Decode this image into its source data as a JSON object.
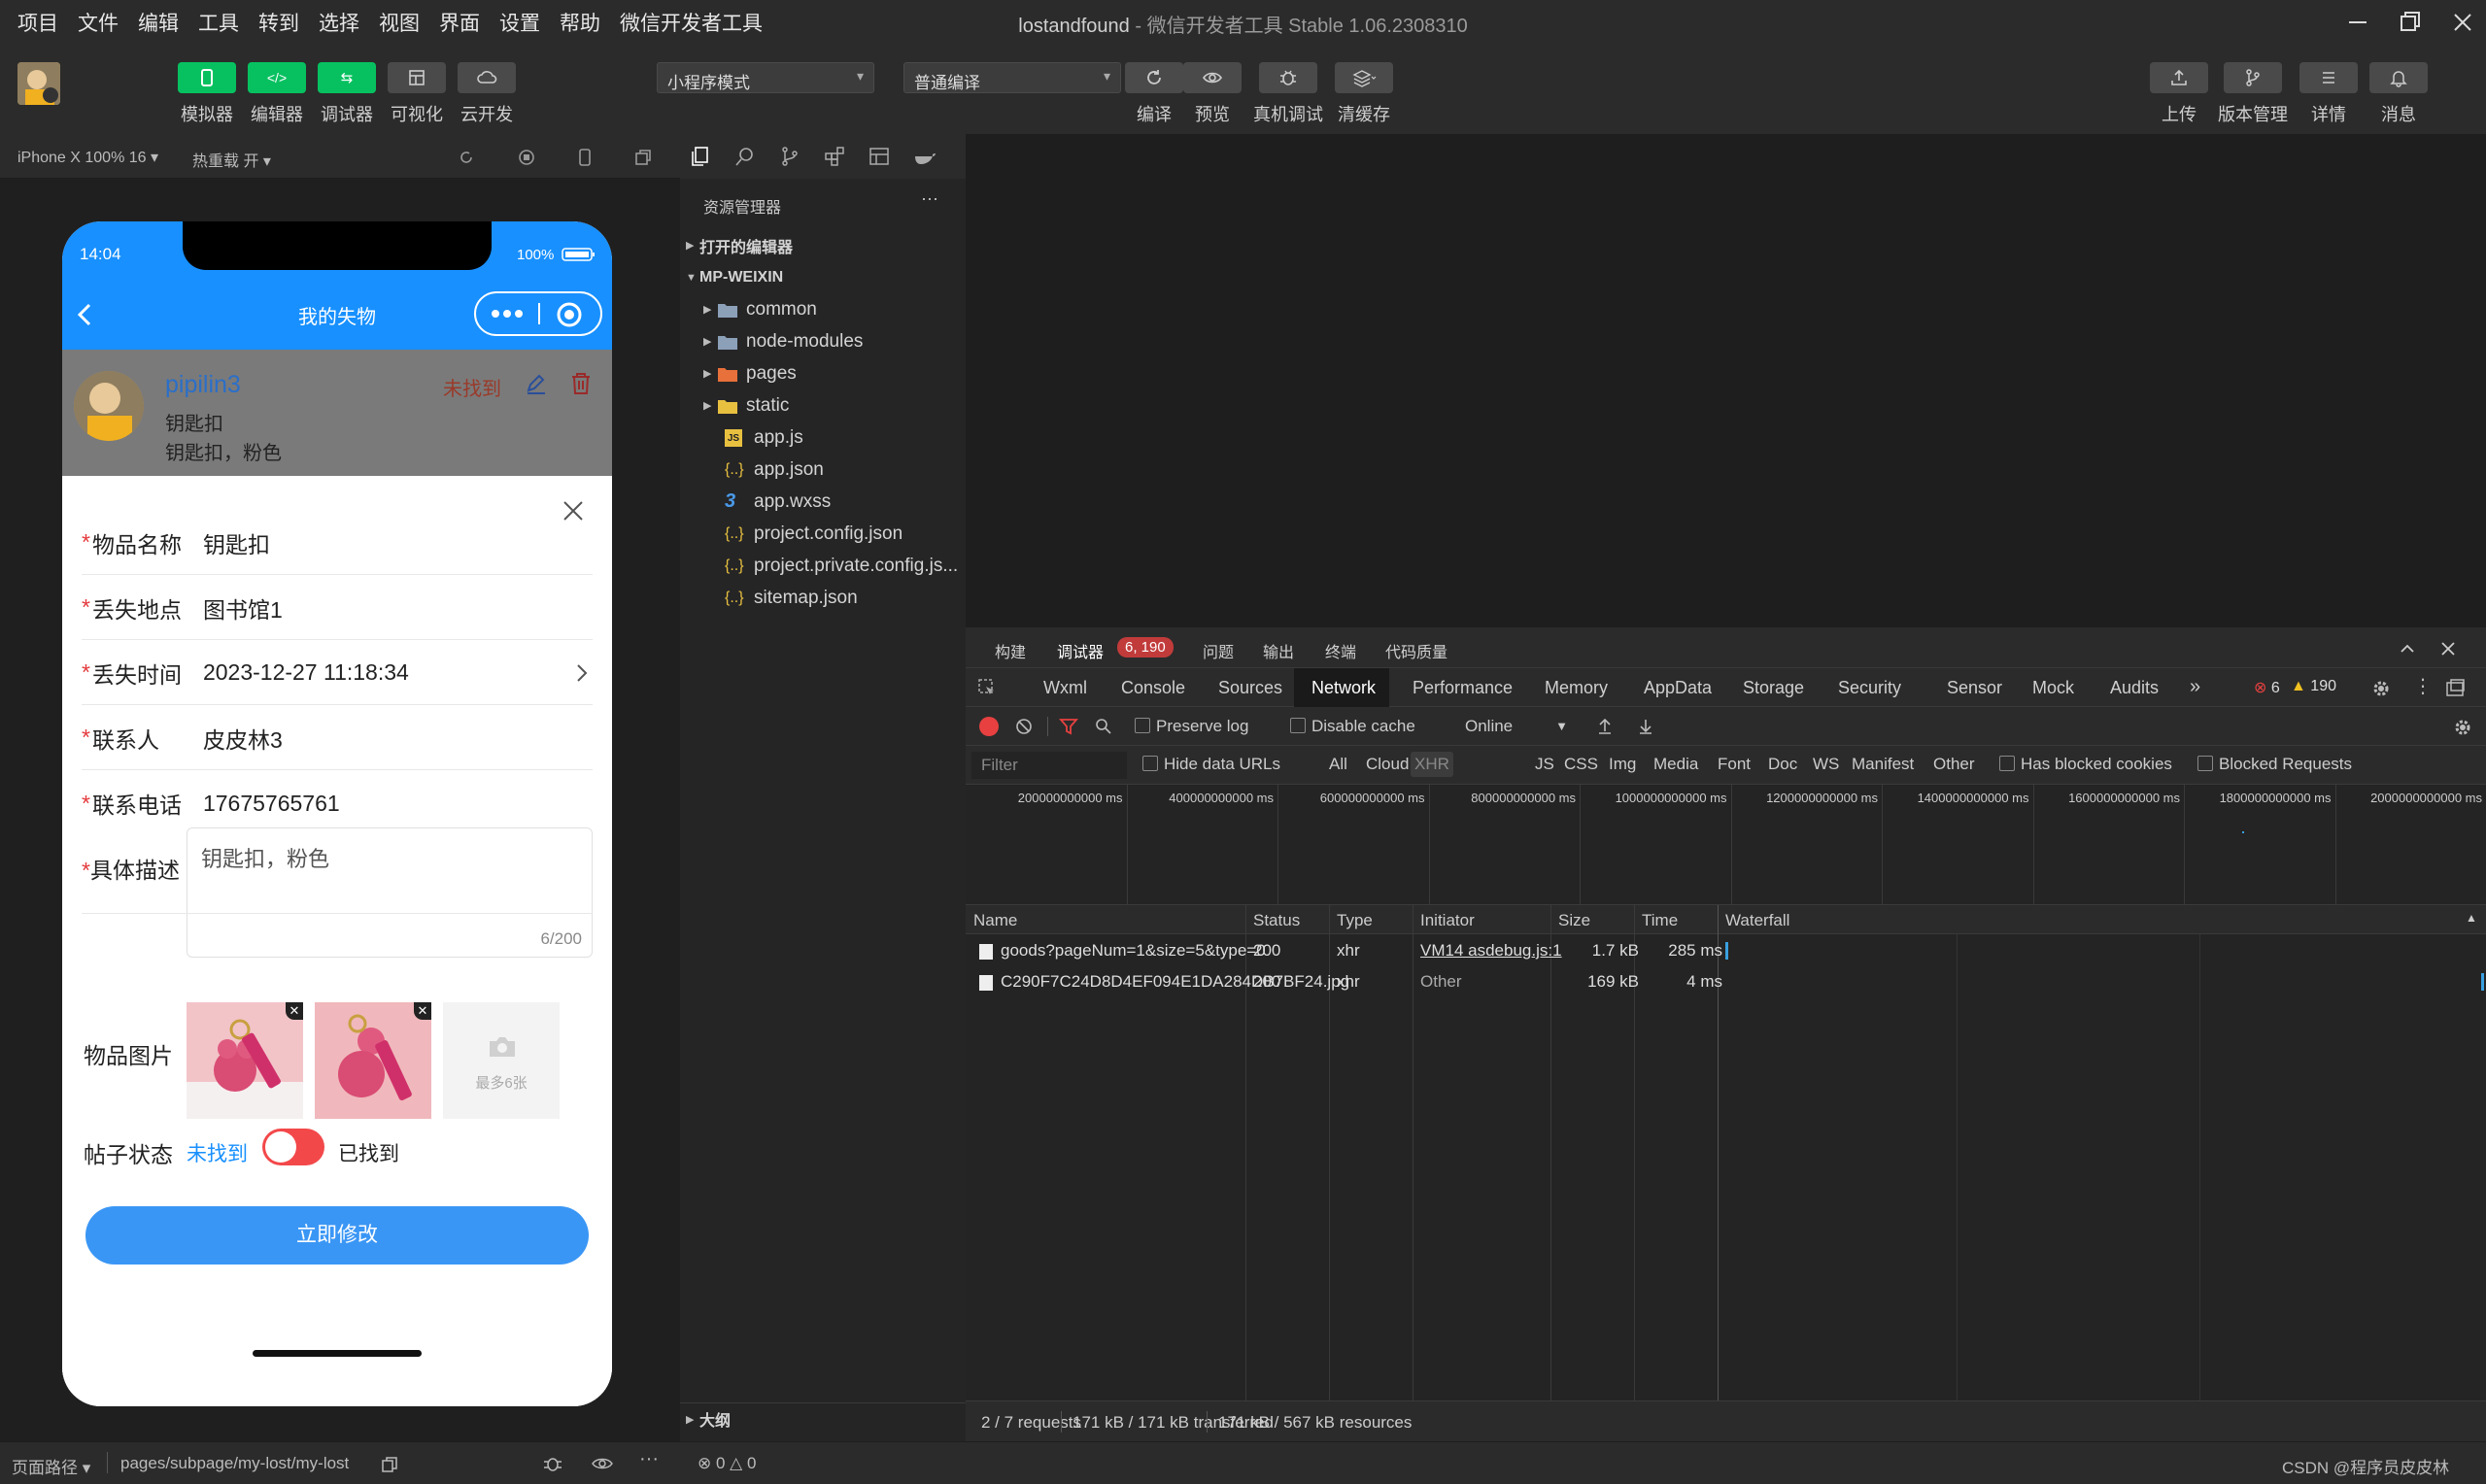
{
  "menubar": {
    "items": [
      "项目",
      "文件",
      "编辑",
      "工具",
      "转到",
      "选择",
      "视图",
      "界面",
      "设置",
      "帮助",
      "微信开发者工具"
    ],
    "project": "lostandfound",
    "app_title": "- 微信开发者工具 Stable 1.06.2308310"
  },
  "toolbar": {
    "left_buttons": [
      "模拟器",
      "编辑器",
      "调试器",
      "可视化",
      "云开发"
    ],
    "mode_select": "小程序模式",
    "compile_select": "普通编译",
    "mid_buttons": [
      "编译",
      "预览",
      "真机调试",
      "清缓存"
    ],
    "right_buttons": [
      "上传",
      "版本管理",
      "详情",
      "消息"
    ]
  },
  "simulator": {
    "device": "iPhone X 100% 16",
    "hotreload": "热重载 开",
    "status_time": "14:04",
    "battery": "100%",
    "nav_title": "我的失物",
    "item": {
      "user": "pipilin3",
      "status": "未找到",
      "name": "钥匙扣",
      "desc": "钥匙扣，粉色"
    },
    "form": {
      "fields": [
        {
          "label": "物品名称",
          "value": "钥匙扣",
          "required": true
        },
        {
          "label": "丢失地点",
          "value": "图书馆1",
          "required": true
        },
        {
          "label": "丢失时间",
          "value": "2023-12-27 11:18:34",
          "required": true
        },
        {
          "label": "联系人",
          "value": "皮皮林3",
          "required": true
        },
        {
          "label": "联系电话",
          "value": "17675765761",
          "required": true
        }
      ],
      "desc_label": "具体描述",
      "desc_value": "钥匙扣，粉色",
      "desc_count": "6/200",
      "images_label": "物品图片",
      "upload_hint": "最多6张",
      "post_status_label": "帖子状态",
      "status_off": "未找到",
      "status_on": "已找到",
      "submit": "立即修改"
    }
  },
  "explorer": {
    "title": "资源管理器",
    "open_editors": "打开的编辑器",
    "root": "MP-WEIXIN",
    "folders": [
      "common",
      "node-modules",
      "pages",
      "static"
    ],
    "files": [
      "app.js",
      "app.json",
      "app.wxss",
      "project.config.json",
      "project.private.config.js...",
      "sitemap.json"
    ],
    "outline": "大纲"
  },
  "devtools": {
    "top_tabs": [
      "构建",
      "调试器",
      "问题",
      "输出",
      "终端",
      "代码质量"
    ],
    "debugger_badge": "6, 190",
    "panel_tabs": [
      "Wxml",
      "Console",
      "Sources",
      "Network",
      "Performance",
      "Memory",
      "AppData",
      "Storage",
      "Security",
      "Sensor",
      "Mock",
      "Audits"
    ],
    "errors": "6",
    "warnings": "190",
    "preserve_log": "Preserve log",
    "disable_cache": "Disable cache",
    "throttle": "Online",
    "filter_placeholder": "Filter",
    "hide_data_urls": "Hide data URLs",
    "filter_types": [
      "All",
      "Cloud",
      "XHR",
      "JS",
      "CSS",
      "Img",
      "Media",
      "Font",
      "Doc",
      "WS",
      "Manifest",
      "Other"
    ],
    "has_blocked": "Has blocked cookies",
    "blocked_requests": "Blocked Requests",
    "timeline_ticks": [
      "200000000000 ms",
      "400000000000 ms",
      "600000000000 ms",
      "800000000000 ms",
      "1000000000000 ms",
      "1200000000000 ms",
      "1400000000000 ms",
      "1600000000000 ms",
      "1800000000000 ms",
      "2000000000000 ms"
    ],
    "columns": [
      "Name",
      "Status",
      "Type",
      "Initiator",
      "Size",
      "Time",
      "Waterfall"
    ],
    "rows": [
      {
        "name": "goods?pageNum=1&size=5&type=0",
        "status": "200",
        "type": "xhr",
        "initiator": "VM14 asdebug.js:1",
        "size": "1.7 kB",
        "time": "285 ms"
      },
      {
        "name": "C290F7C24D8D4EF094E1DA284DB7BF24.jpg",
        "status": "200",
        "type": "xhr",
        "initiator": "Other",
        "size": "169 kB",
        "time": "4 ms"
      }
    ],
    "summary": [
      "2 / 7 requests",
      "171 kB / 171 kB transferred",
      "171 kB / 567 kB resources"
    ]
  },
  "statusbar": {
    "path_label": "页面路径",
    "path": "pages/subpage/my-lost/my-lost",
    "errors": "0",
    "warnings": "0",
    "watermark": "CSDN @程序员皮皮林"
  },
  "colors": {
    "accent": "#1890ff",
    "green": "#07c160",
    "danger": "#e4393c"
  }
}
